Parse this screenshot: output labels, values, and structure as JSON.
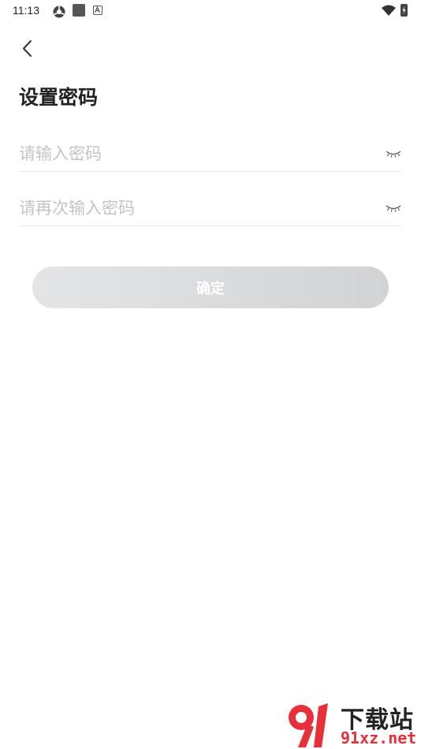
{
  "status_bar": {
    "time": "11:13",
    "icons": [
      "gear-icon",
      "app-square-icon",
      "a-badge-icon",
      "wifi-icon",
      "battery-charging-icon"
    ]
  },
  "nav": {
    "back_icon": "chevron-left-icon"
  },
  "page": {
    "title": "设置密码"
  },
  "form": {
    "password_placeholder": "请输入密码",
    "password_value": "",
    "confirm_placeholder": "请再次输入密码",
    "confirm_value": "",
    "visibility_icon": "eye-closed-icon"
  },
  "confirm_button": {
    "label": "确定"
  },
  "watermark": {
    "logo_text": "91",
    "title": "下载站",
    "domain": "91xz.net",
    "accent_color": "#e8303a"
  }
}
